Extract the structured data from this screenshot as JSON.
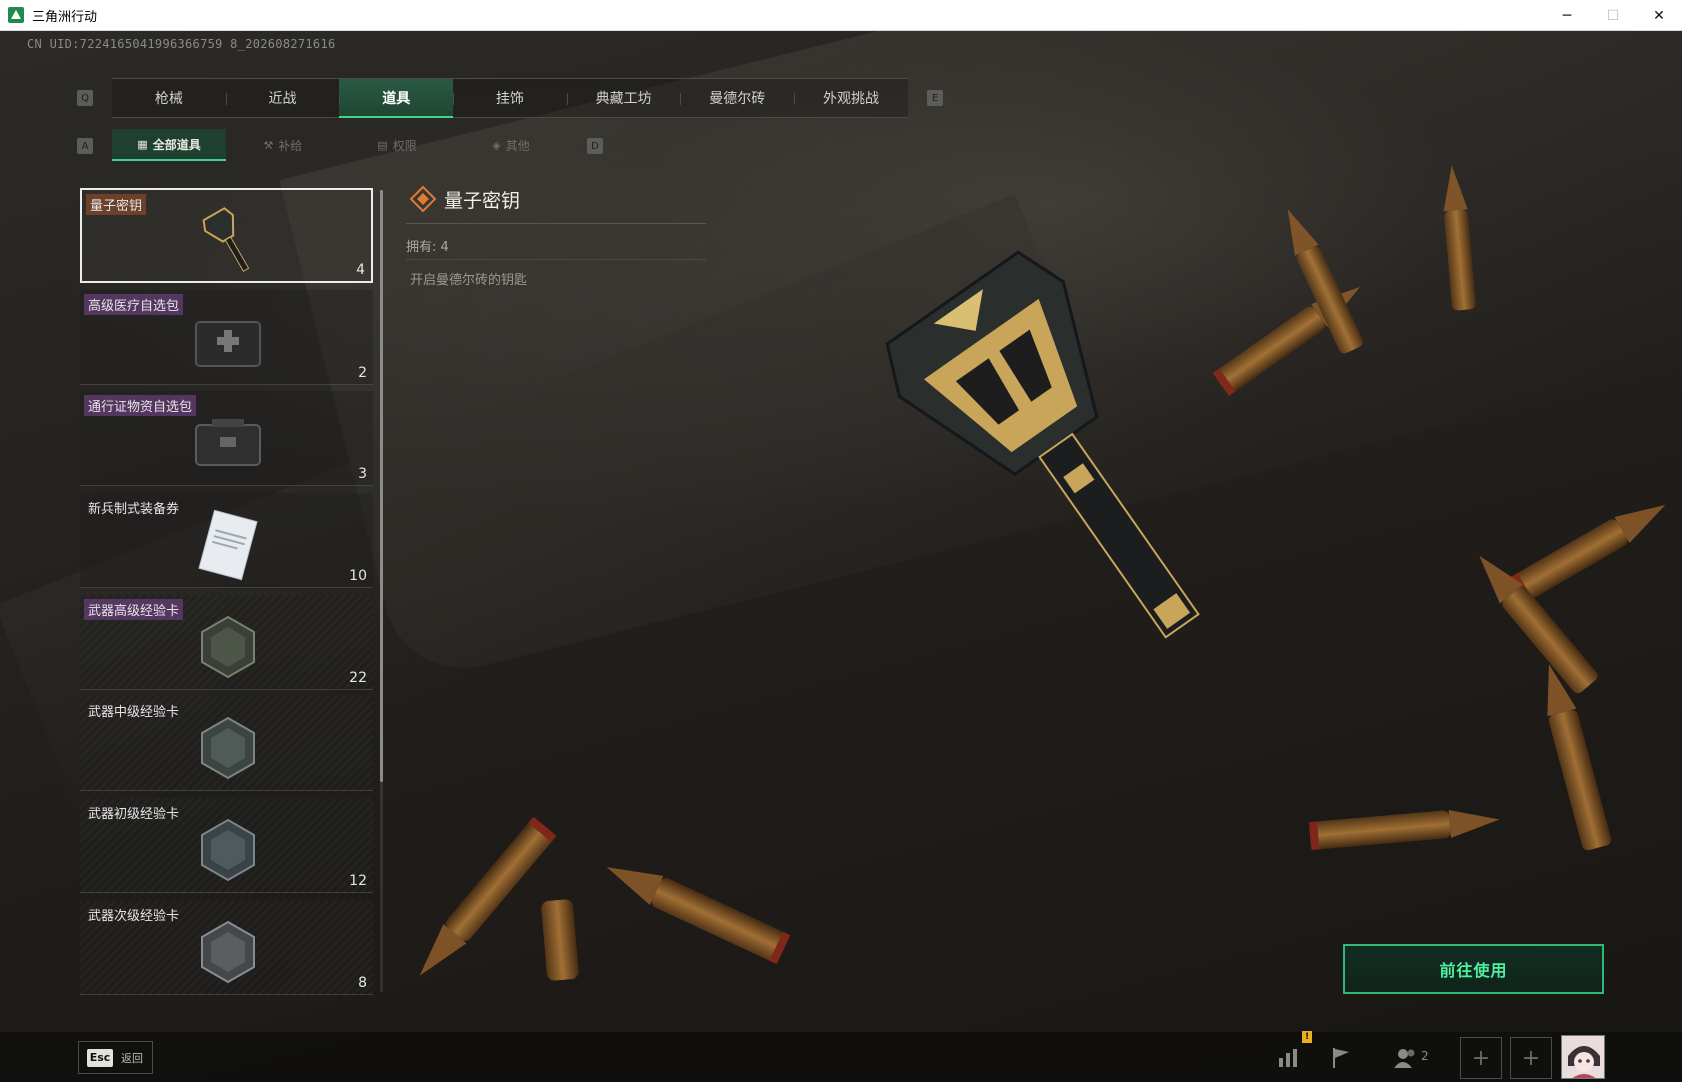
{
  "window": {
    "title": "三角洲行动",
    "minimize": "─",
    "maximize": "☐",
    "close": "✕"
  },
  "uid": "CN UID:7224165041996366759 8_202608271616",
  "tabs": {
    "left_key": "Q",
    "right_key": "E",
    "items": [
      {
        "label": "枪械"
      },
      {
        "label": "近战"
      },
      {
        "label": "道具",
        "active": true
      },
      {
        "label": "挂饰"
      },
      {
        "label": "典藏工坊"
      },
      {
        "label": "曼德尔砖"
      },
      {
        "label": "外观挑战"
      }
    ]
  },
  "subtabs": {
    "left_key": "A",
    "right_key": "D",
    "items": [
      {
        "label": "全部道具",
        "icon": "grid-icon",
        "active": true
      },
      {
        "label": "补给",
        "icon": "supply-icon"
      },
      {
        "label": "权限",
        "icon": "permission-icon"
      },
      {
        "label": "其他",
        "icon": "other-icon"
      }
    ]
  },
  "items": [
    {
      "name": "量子密钥",
      "count": "4",
      "rarity": "orange",
      "selected": true
    },
    {
      "name": "高级医疗自选包",
      "count": "2",
      "rarity": "purple"
    },
    {
      "name": "通行证物资自选包",
      "count": "3",
      "rarity": "purple"
    },
    {
      "name": "新兵制式装备券",
      "count": "10",
      "rarity": "none"
    },
    {
      "name": "武器高级经验卡",
      "count": "22",
      "rarity": "purple"
    },
    {
      "name": "武器中级经验卡",
      "count": "",
      "rarity": "none"
    },
    {
      "name": "武器初级经验卡",
      "count": "12",
      "rarity": "none"
    },
    {
      "name": "武器次级经验卡",
      "count": "8",
      "rarity": "none"
    }
  ],
  "detail": {
    "title": "量子密钥",
    "owned": "拥有: 4",
    "description": "开启曼德尔砖的钥匙"
  },
  "use_button": "前往使用",
  "bottom": {
    "esc_key": "Esc",
    "esc_label": "返回",
    "badge": "!",
    "friend_count": "2",
    "plus": "+"
  },
  "colors": {
    "accent": "#3fd48a",
    "tab_active": "#2b5a44",
    "rarity_orange": "#a05028",
    "rarity_purple": "#68407a"
  }
}
